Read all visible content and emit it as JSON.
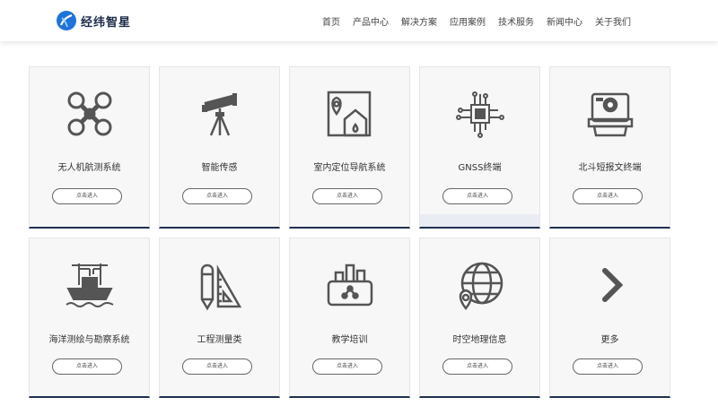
{
  "header": {
    "logo_text": "经纬智星",
    "nav": [
      "首页",
      "产品中心",
      "解决方案",
      "应用案例",
      "技术服务",
      "新闻中心",
      "关于我们"
    ]
  },
  "cards": [
    {
      "title": "无人机航测系统",
      "button": "点击进入",
      "icon": "drone-icon"
    },
    {
      "title": "智能传感",
      "button": "点击进入",
      "icon": "telescope-icon"
    },
    {
      "title": "室内定位导航系统",
      "button": "点击进入",
      "icon": "indoor-map-pin-icon"
    },
    {
      "title": "GNSS终端",
      "button": "点击进入",
      "icon": "chip-circuit-icon"
    },
    {
      "title": "北斗短报文终端",
      "button": "点击进入",
      "icon": "printer-terminal-icon"
    },
    {
      "title": "海洋测绘与勘察系统",
      "button": "点击进入",
      "icon": "ship-crane-icon"
    },
    {
      "title": "工程测量类",
      "button": "点击进入",
      "icon": "pencil-ruler-icon"
    },
    {
      "title": "教学培训",
      "button": "点击进入",
      "icon": "education-box-icon"
    },
    {
      "title": "时空地理信息",
      "button": "点击进入",
      "icon": "globe-pin-icon"
    },
    {
      "title": "更多",
      "button": "点击进入",
      "icon": "chevron-right-icon"
    }
  ],
  "colors": {
    "accent": "#1f3150",
    "icon": "#555555",
    "card_bg": "#f7f7f7",
    "logo_blue": "#1e73d8"
  }
}
